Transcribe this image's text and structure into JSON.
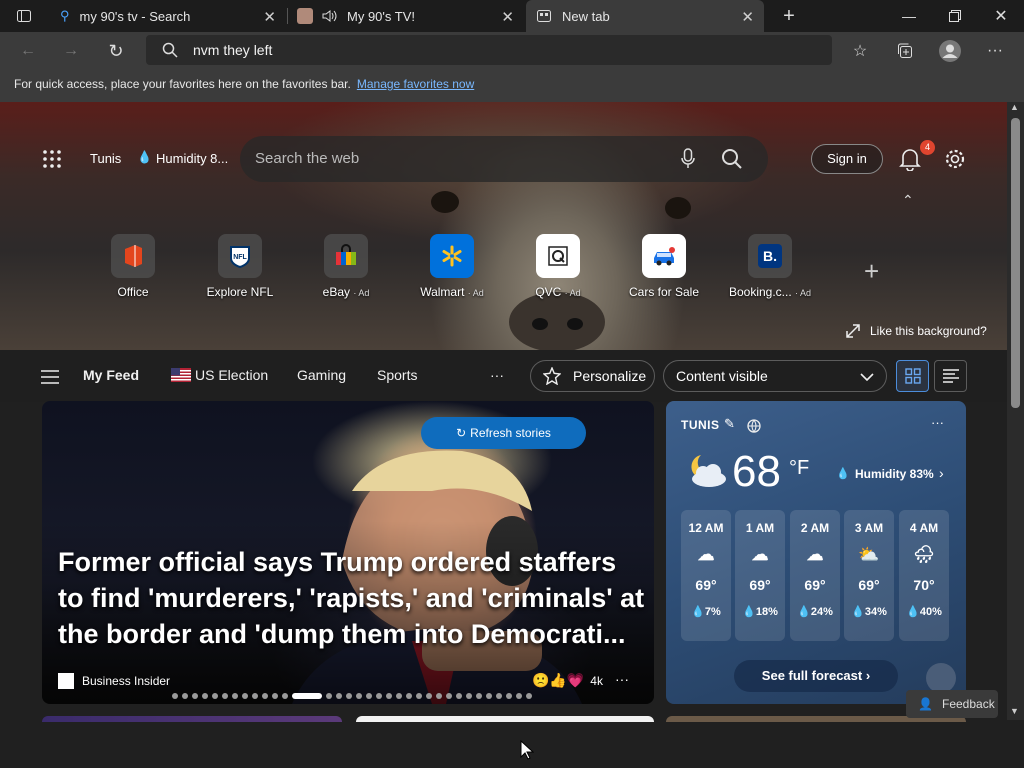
{
  "tabs": [
    {
      "title": "my 90's tv - Search",
      "icon": "bing-search-icon"
    },
    {
      "title": "My 90's TV!",
      "icon": "speaker-icon"
    },
    {
      "title": "New tab",
      "icon": "newtab-icon"
    }
  ],
  "address": {
    "query": "nvm they left"
  },
  "favorites_bar": {
    "message": "For quick access, place your favorites here on the favorites bar.",
    "link": "Manage favorites now"
  },
  "hero": {
    "location": "Tunis",
    "humidity_short": "Humidity 8...",
    "search_placeholder": "Search the web",
    "sign_in": "Sign in",
    "notification_count": "4",
    "like_background": "Like this background?"
  },
  "quick_links": [
    {
      "label": "Office",
      "ad": ""
    },
    {
      "label": "Explore NFL",
      "ad": ""
    },
    {
      "label": "eBay",
      "ad": "· Ad"
    },
    {
      "label": "Walmart",
      "ad": "· Ad"
    },
    {
      "label": "QVC",
      "ad": "· Ad"
    },
    {
      "label": "Cars for Sale",
      "ad": ""
    },
    {
      "label": "Booking.c...",
      "ad": "· Ad"
    }
  ],
  "feed_nav": {
    "my_feed": "My Feed",
    "us_election": "US Election",
    "gaming": "Gaming",
    "sports": "Sports",
    "more": "···",
    "personalize": "Personalize",
    "content_visible": "Content visible"
  },
  "story": {
    "refresh": "Refresh stories",
    "headline": "Former official says Trump ordered staffers to find 'murderers,' 'rapists,' and 'criminals' at the border and 'dump them into Democrati...",
    "source": "Business Insider",
    "reactions": "4k",
    "dot_count": 34,
    "active_dot": 12
  },
  "weather": {
    "city": "TUNIS",
    "temp": "68",
    "unit": "°F",
    "humidity": "Humidity 83%",
    "hours": [
      {
        "time": "12 AM",
        "temp": "69°",
        "precip": "7%",
        "icon": "cloud-icon"
      },
      {
        "time": "1 AM",
        "temp": "69°",
        "precip": "18%",
        "icon": "cloud-icon"
      },
      {
        "time": "2 AM",
        "temp": "69°",
        "precip": "24%",
        "icon": "cloud-icon"
      },
      {
        "time": "3 AM",
        "temp": "69°",
        "precip": "34%",
        "icon": "partly-cloudy-icon"
      },
      {
        "time": "4 AM",
        "temp": "70°",
        "precip": "40%",
        "icon": "rain-cloud-icon"
      }
    ],
    "full_forecast": "See full forecast"
  },
  "feedback": "Feedback"
}
